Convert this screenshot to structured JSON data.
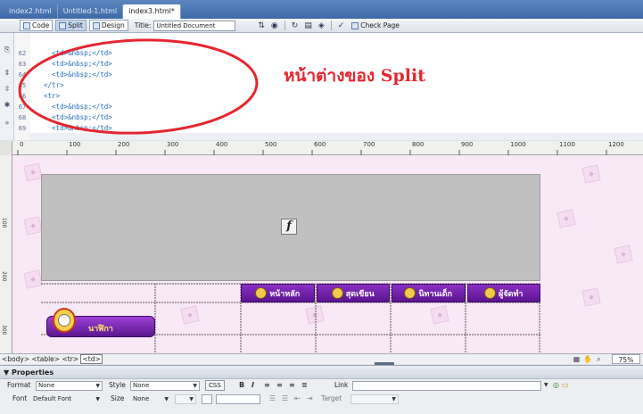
{
  "tabs": [
    {
      "label": "index2.html",
      "active": false
    },
    {
      "label": "Untitled-1.html",
      "active": false
    },
    {
      "label": "index3.html*",
      "active": true
    }
  ],
  "toolbar": {
    "code_label": "Code",
    "split_label": "Split",
    "design_label": "Design",
    "title_label": "Title:",
    "title_value": "Untitled Document",
    "check_page_label": "Check Page"
  },
  "code": {
    "lines": [
      {
        "num": "62",
        "text": "    <td>&nbsp;</td>"
      },
      {
        "num": "63",
        "text": "    <td>&nbsp;</td>"
      },
      {
        "num": "64",
        "text": "    <td>&nbsp;</td>"
      },
      {
        "num": "65",
        "text": "  </tr>"
      },
      {
        "num": "66",
        "text": "  <tr>"
      },
      {
        "num": "67",
        "text": "    <td>&nbsp;</td>"
      },
      {
        "num": "68",
        "text": "    <td>&nbsp;</td>"
      },
      {
        "num": "69",
        "text": "    <td>&nbsp;</td>"
      }
    ]
  },
  "annotation": {
    "text": "หน้าต่างของ Split",
    "color": "#e5262f"
  },
  "ruler": {
    "labels": [
      "0",
      "100",
      "200",
      "300",
      "400",
      "500",
      "600",
      "700",
      "800",
      "900",
      "1000",
      "1100",
      "1200"
    ],
    "vlabels": [
      "100",
      "200",
      "300"
    ]
  },
  "design": {
    "nav": [
      {
        "label": "หน้าหลัก"
      },
      {
        "label": "สุดเขียน"
      },
      {
        "label": "นิทานเด็ก"
      },
      {
        "label": "ผู้จัดทำ"
      }
    ],
    "clock_label": "นาฬิกา",
    "accent": "#6a1fa3"
  },
  "status": {
    "tags": [
      "<body>",
      "<table>",
      "<tr>",
      "<td>"
    ],
    "zoom": "75%"
  },
  "properties": {
    "header": "Properties",
    "format_label": "Format",
    "format_value": "None",
    "style_label": "Style",
    "style_value": "None",
    "css_label": "CSS",
    "link_label": "Link",
    "font_label": "Font",
    "font_value": "Default Font",
    "size_label": "Size",
    "size_value": "None",
    "target_label": "Target"
  }
}
